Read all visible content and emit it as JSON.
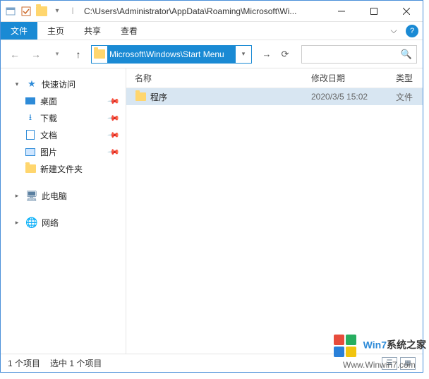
{
  "titlebar": {
    "path": "C:\\Users\\Administrator\\AppData\\Roaming\\Microsoft\\Wi..."
  },
  "ribbon": {
    "file": "文件",
    "home": "主页",
    "share": "共享",
    "view": "查看"
  },
  "nav": {
    "address_selected": "Microsoft\\Windows\\Start Menu"
  },
  "sidebar": {
    "quick_access": "快速访问",
    "items": [
      {
        "label": "桌面"
      },
      {
        "label": "下载"
      },
      {
        "label": "文档"
      },
      {
        "label": "图片"
      },
      {
        "label": "新建文件夹"
      }
    ],
    "this_pc": "此电脑",
    "network": "网络"
  },
  "columns": {
    "name": "名称",
    "date": "修改日期",
    "type": "类型"
  },
  "files": [
    {
      "name": "程序",
      "date": "2020/3/5 15:02",
      "type": "文件"
    }
  ],
  "status": {
    "count": "1 个项目",
    "selection": "选中 1 个项目"
  },
  "watermark": {
    "brand_a": "Win7",
    "brand_b": "系统之家",
    "url": "Www.Winwin7.com"
  }
}
